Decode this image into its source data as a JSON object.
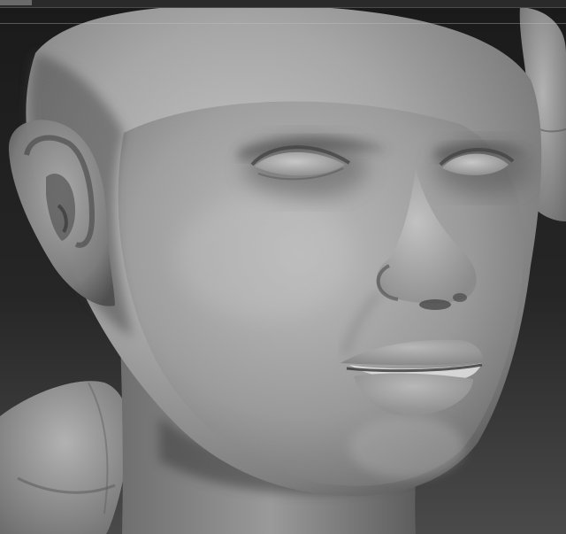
{
  "viewport": {
    "subject": "sculpted-head",
    "colors": {
      "background_top": "#1a1a1a",
      "background_bottom": "#4a4a4a",
      "clay_light": "#bdbdbd",
      "clay_mid": "#8d8d8d",
      "clay_dark": "#3a3a3a",
      "toolbar": "#2a2a2a"
    }
  }
}
